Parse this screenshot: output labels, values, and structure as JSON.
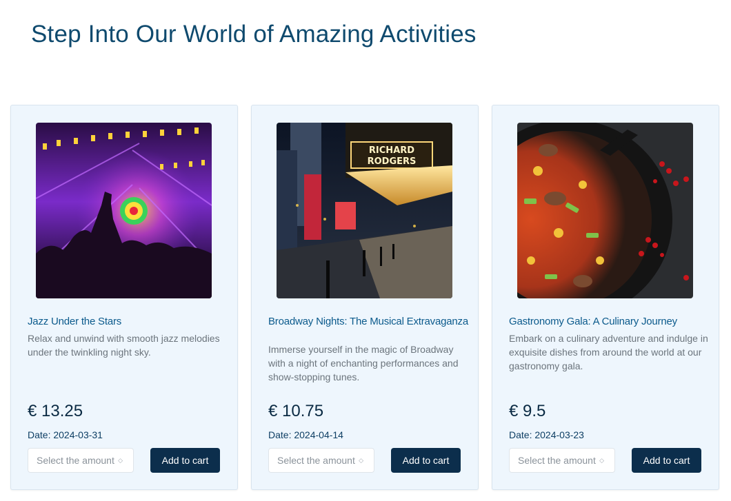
{
  "page": {
    "title": "Step Into Our World of Amazing Activities"
  },
  "activities": [
    {
      "title": "Jazz Under the Stars",
      "description": "Relax and unwind with smooth jazz melodies under the twinkling night sky.",
      "price": "€ 13.25",
      "date": "Date: 2024-03-31",
      "amount_placeholder": "Select the amount",
      "button_label": "Add to cart"
    },
    {
      "title": "Broadway Nights: The Musical Extravaganza",
      "description": "Immerse yourself in the magic of Broadway with a night of enchanting performances and show-stopping tunes.",
      "price": "€ 10.75",
      "date": "Date: 2024-04-14",
      "amount_placeholder": "Select the amount",
      "button_label": "Add to cart"
    },
    {
      "title": "Gastronomy Gala: A Culinary Journey",
      "description": "Embark on a culinary adventure and indulge in exquisite dishes from around the world at our gastronomy gala.",
      "price": "€ 9.5",
      "date": "Date: 2024-03-23",
      "amount_placeholder": "Select the amount",
      "button_label": "Add to cart"
    }
  ],
  "icons": {
    "select_arrow": "chevron-updown-icon"
  },
  "colors": {
    "title": "#0f4a6e",
    "card_bg": "#eef6fd",
    "button_bg": "#0c2e4c",
    "card_title": "#0b5a8c"
  }
}
